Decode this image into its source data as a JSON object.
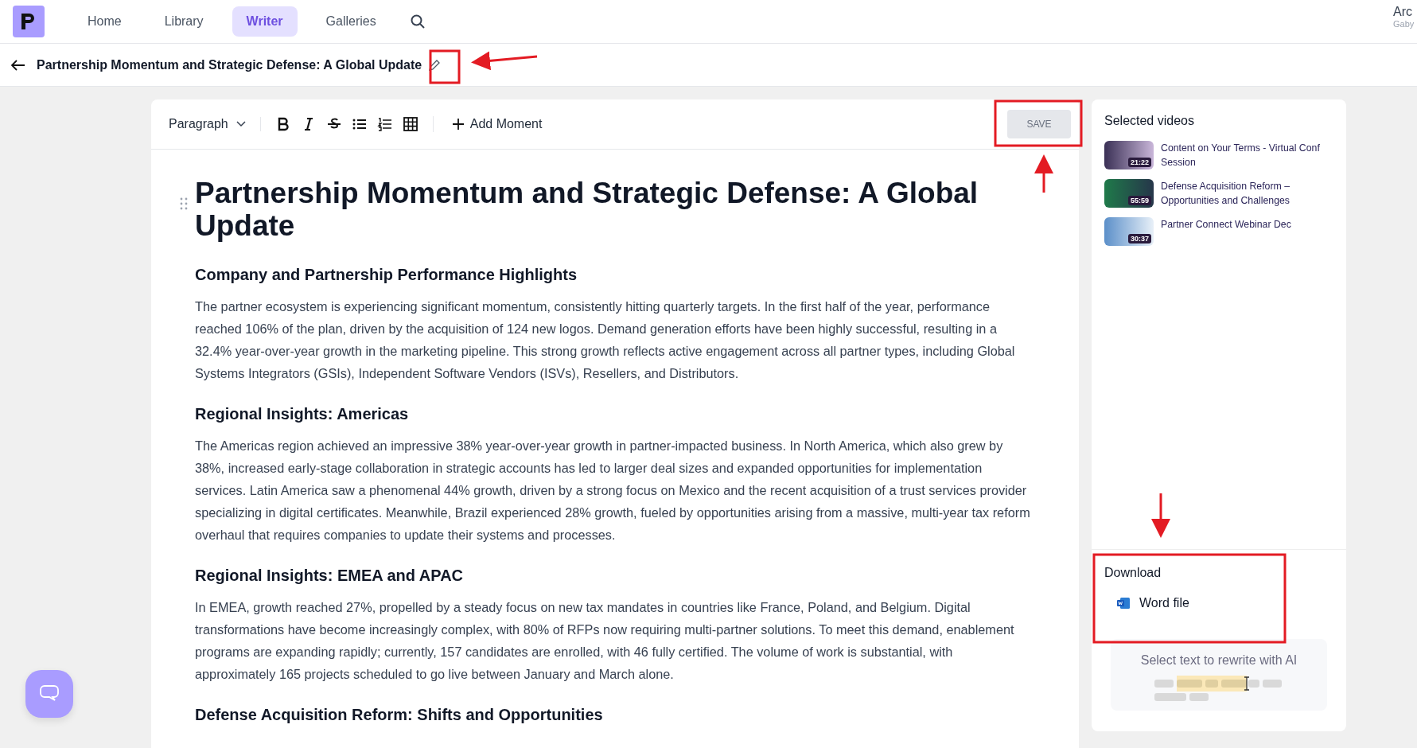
{
  "nav": {
    "items": [
      {
        "label": "Home",
        "selected": false
      },
      {
        "label": "Library",
        "selected": false
      },
      {
        "label": "Writer",
        "selected": true
      },
      {
        "label": "Galleries",
        "selected": false
      }
    ]
  },
  "user": {
    "name": "Arc",
    "subtitle": "Gaby"
  },
  "document": {
    "title": "Partnership Momentum and Strategic Defense: A Global Update"
  },
  "toolbar": {
    "block_style": "Paragraph",
    "add_moment": "Add Moment",
    "save": {
      "label": "SAVE",
      "disabled": true
    }
  },
  "editor": {
    "heading": "Partnership Momentum and Strategic Defense: A Global Update",
    "sections": [
      {
        "heading": "Company and Partnership Performance Highlights",
        "paragraph": "The partner ecosystem is experiencing significant momentum, consistently hitting quarterly targets. In the first half of the year, performance reached 106% of the plan, driven by the acquisition of 124 new logos. Demand generation efforts have been highly successful, resulting in a 32.4% year-over-year growth in the marketing pipeline. This strong growth reflects active engagement across all partner types, including Global Systems Integrators (GSIs), Independent Software Vendors (ISVs), Resellers, and Distributors."
      },
      {
        "heading": "Regional Insights: Americas",
        "paragraph": "The Americas region achieved an impressive 38% year-over-year growth in partner-impacted business. In North America, which also grew by 38%, increased early-stage collaboration in strategic accounts has led to larger deal sizes and expanded opportunities for implementation services. Latin America saw a phenomenal 44% growth, driven by a strong focus on Mexico and the recent acquisition of a trust services provider specializing in digital certificates. Meanwhile, Brazil experienced 28% growth, fueled by opportunities arising from a massive, multi-year tax reform overhaul that requires companies to update their systems and processes."
      },
      {
        "heading": "Regional Insights: EMEA and APAC",
        "paragraph": "In EMEA, growth reached 27%, propelled by a steady focus on new tax mandates in countries like France, Poland, and Belgium. Digital transformations have become increasingly complex, with 80% of RFPs now requiring multi-partner solutions. To meet this demand, enablement programs are expanding rapidly; currently, 157 candidates are enrolled, with 46 fully certified. The volume of work is substantial, with approximately 165 projects scheduled to go live between January and March alone."
      },
      {
        "heading": "Defense Acquisition Reform: Shifts and Opportunities"
      }
    ]
  },
  "selected_videos": {
    "title": "Selected videos",
    "items": [
      {
        "title": "Content on Your Terms - Virtual Conf Session",
        "duration": "21:22"
      },
      {
        "title": "Defense Acquisition Reform – Opportunities and Challenges",
        "duration": "55:59"
      },
      {
        "title": "Partner Connect Webinar Dec",
        "duration": "30:37"
      }
    ]
  },
  "download": {
    "title": "Download",
    "items": [
      {
        "label": "Word file"
      }
    ]
  },
  "ai_hint": {
    "text": "Select text to rewrite with AI"
  }
}
